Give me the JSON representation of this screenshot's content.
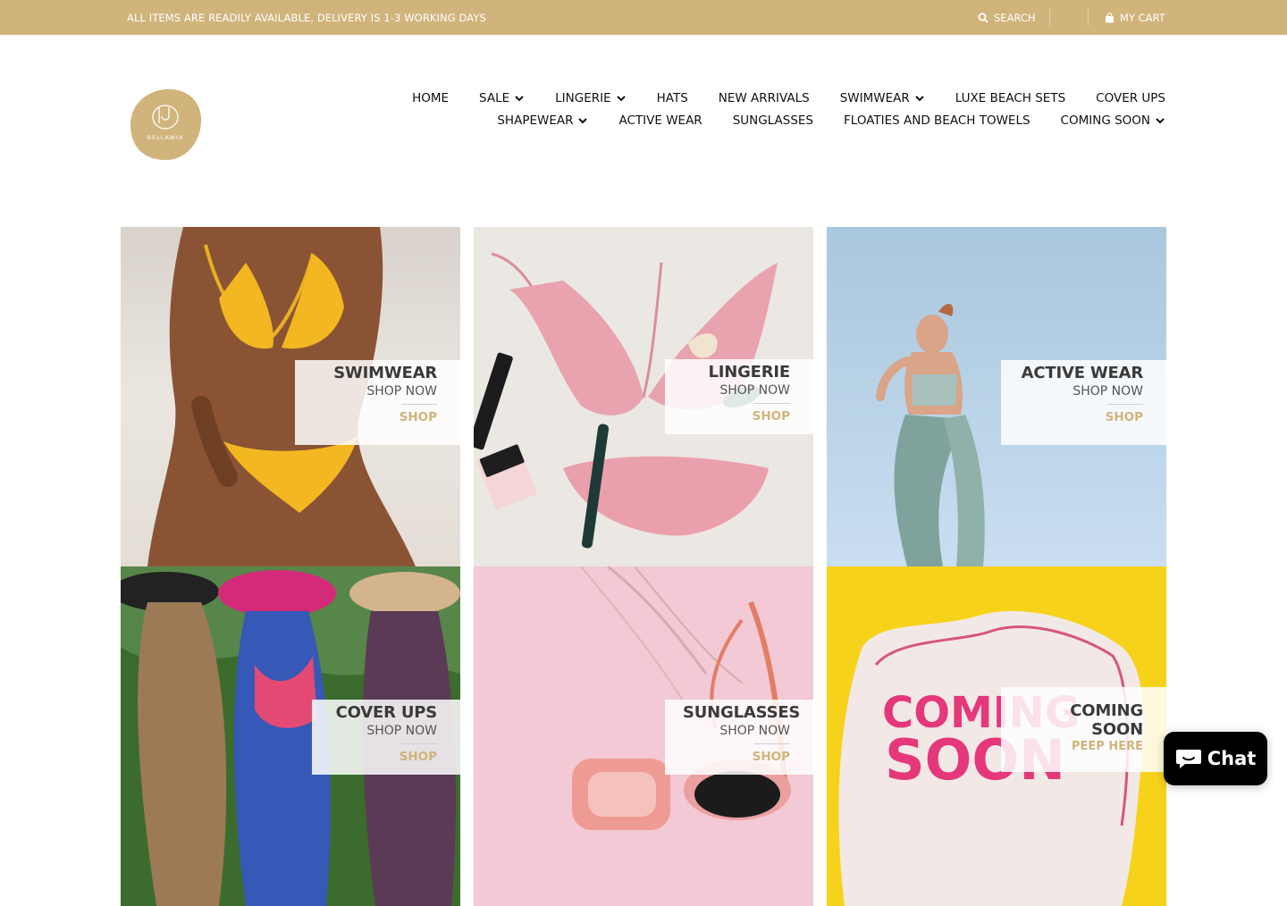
{
  "topbar": {
    "notice": "ALL ITEMS ARE READILY AVAILABLE, DELIVERY IS 1-3 WORKING DAYS",
    "search_label": "SEARCH",
    "cart_label": "MY CART"
  },
  "logo": {
    "text": "BELLAWIX"
  },
  "nav": {
    "row1": [
      {
        "label": "HOME",
        "dropdown": false
      },
      {
        "label": "SALE",
        "dropdown": true
      },
      {
        "label": "LINGERIE",
        "dropdown": true
      },
      {
        "label": "HATS",
        "dropdown": false
      },
      {
        "label": "NEW ARRIVALS",
        "dropdown": false
      },
      {
        "label": "SWIMWEAR",
        "dropdown": true
      },
      {
        "label": "LUXE BEACH SETS",
        "dropdown": false
      },
      {
        "label": "COVER UPS",
        "dropdown": false
      }
    ],
    "row2": [
      {
        "label": "SHAPEWEAR",
        "dropdown": true
      },
      {
        "label": "ACTIVE WEAR",
        "dropdown": false
      },
      {
        "label": "SUNGLASSES",
        "dropdown": false
      },
      {
        "label": "FLOATIES AND BEACH TOWELS",
        "dropdown": false
      },
      {
        "label": "COMING SOON",
        "dropdown": true
      }
    ]
  },
  "tiles": [
    {
      "title": "SWIMWEAR",
      "subtitle": "SHOP NOW",
      "cta": "SHOP"
    },
    {
      "title": "LINGERIE",
      "subtitle": "SHOP NOW",
      "cta": "SHOP"
    },
    {
      "title": "ACTIVE WEAR",
      "subtitle": "SHOP NOW",
      "cta": "SHOP"
    },
    {
      "title": "COVER UPS",
      "subtitle": "SHOP NOW",
      "cta": "SHOP"
    },
    {
      "title": "SUNGLASSES",
      "subtitle": "SHOP NOW",
      "cta": "SHOP"
    },
    {
      "title": "COMING SOON",
      "subtitle": "PEEP HERE",
      "art_text_1": "COMING",
      "art_text_2": "SOON"
    }
  ],
  "chat": {
    "label": "Chat"
  },
  "colors": {
    "brand_gold": "#d0b47b",
    "chat_bg": "#000000"
  },
  "icons": {
    "search": "search-icon",
    "cart": "bag-icon",
    "chat": "chat-bubble-icon",
    "dropdown": "chevron-down-icon"
  }
}
